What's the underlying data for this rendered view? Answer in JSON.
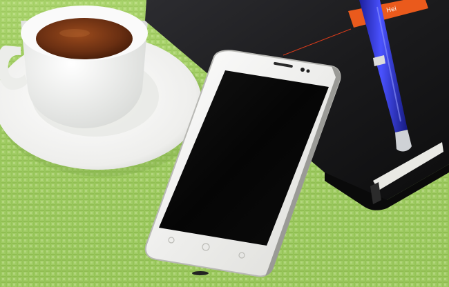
{
  "photo": {
    "colors": {
      "mat": "#a8d36b",
      "mat_dark": "#8fbf52",
      "cup": "#f4f4f2",
      "tea": "#6a2f12",
      "notebook": "#1c1c1e",
      "pen": "#2a2fd0",
      "phone_body": "#f3f3f1",
      "phone_screen": "#050505",
      "tag": "#ea5a1c"
    },
    "objects": [
      "tea-cup",
      "saucer",
      "notebook",
      "pen",
      "smartphone"
    ],
    "tag_text": "Hei"
  }
}
